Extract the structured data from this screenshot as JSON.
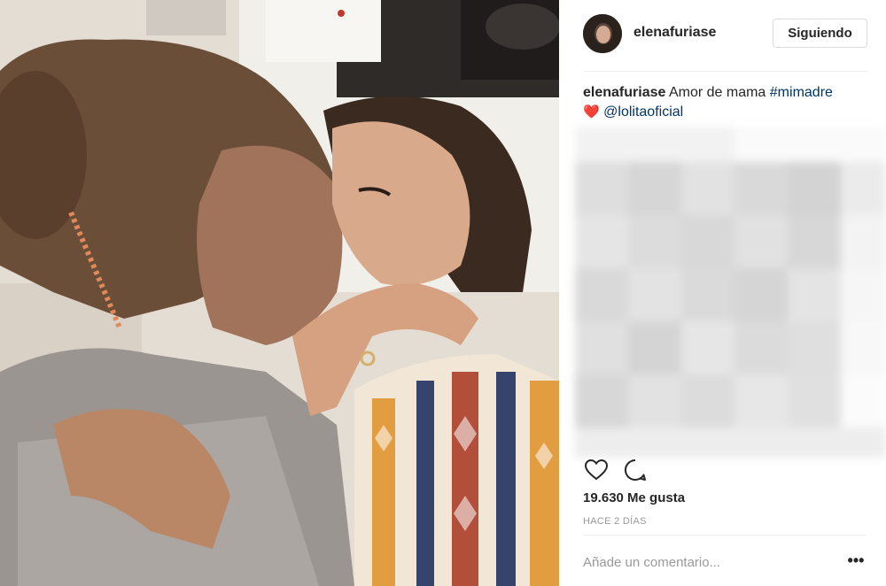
{
  "post": {
    "username": "elenafuriase",
    "follow_label": "Siguiendo",
    "caption": {
      "username": "elenafuriase",
      "text": "Amor de mama",
      "hashtag": "#mimadre",
      "heart_icon": "heart-emoji-icon",
      "mention": "@lolitaoficial"
    },
    "likes": "19.630 Me gusta",
    "time": "HACE 2 DÍAS",
    "comment_placeholder": "Añade un comentario...",
    "more_label": "•••"
  },
  "icons": {
    "like": "heart-outline-icon",
    "comment": "speech-bubble-icon",
    "more": "more-options-icon"
  },
  "colors": {
    "hashtag": "#003569",
    "follow_border": "#dbdbdb",
    "divider": "#efefef",
    "muted": "#999999",
    "heart": "#ed4956"
  }
}
